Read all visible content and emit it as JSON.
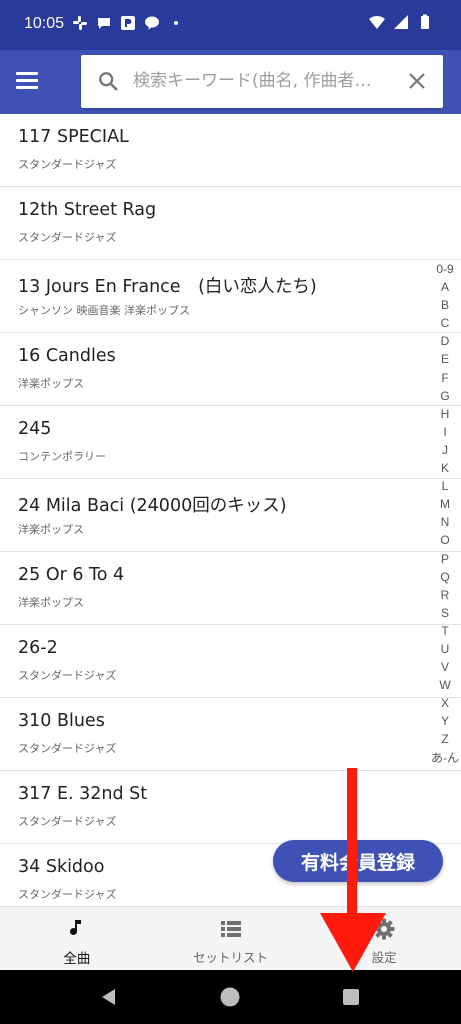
{
  "status_bar": {
    "time": "10:05"
  },
  "search": {
    "placeholder": "検索キーワード(曲名, 作曲者…"
  },
  "songs": [
    {
      "title": "117 SPECIAL",
      "genre": "スタンダードジャズ"
    },
    {
      "title": "12th Street Rag",
      "genre": "スタンダードジャズ"
    },
    {
      "title": "13 Jours En France　(白い恋人たち)",
      "genre": "シャンソン 映画音楽 洋楽ポップス"
    },
    {
      "title": "16 Candles",
      "genre": "洋楽ポップス"
    },
    {
      "title": "245",
      "genre": "コンテンポラリー"
    },
    {
      "title": "24 Mila Baci (24000回のキッス)",
      "genre": "洋楽ポップス"
    },
    {
      "title": "25 Or 6 To 4",
      "genre": "洋楽ポップス"
    },
    {
      "title": "26-2",
      "genre": "スタンダードジャズ"
    },
    {
      "title": "310 Blues",
      "genre": "スタンダードジャズ"
    },
    {
      "title": "317 E. 32nd St",
      "genre": "スタンダードジャズ"
    },
    {
      "title": "34 Skidoo",
      "genre": "スタンダードジャズ"
    }
  ],
  "alpha_index": [
    "0-9",
    "A",
    "B",
    "C",
    "D",
    "E",
    "F",
    "G",
    "H",
    "I",
    "J",
    "K",
    "L",
    "M",
    "N",
    "O",
    "P",
    "Q",
    "R",
    "S",
    "T",
    "U",
    "V",
    "W",
    "X",
    "Y",
    "Z",
    "あ-ん"
  ],
  "premium_button": "有料会員登録",
  "bottom_nav": {
    "all_songs": "全曲",
    "setlist": "セットリスト",
    "settings": "設定"
  },
  "colors": {
    "status_bar": "#2a3a9a",
    "header": "#3f51b5",
    "premium": "#3f51b5",
    "arrow": "#ff1a0e"
  }
}
